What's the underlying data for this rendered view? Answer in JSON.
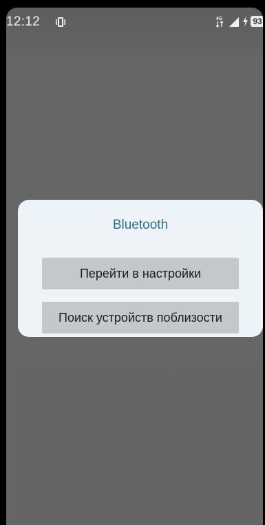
{
  "status_bar": {
    "time": "12:12",
    "network_label": "4G",
    "battery": "93",
    "icons": [
      "vibrate-icon",
      "network-4g-icon",
      "signal-icon",
      "charging-icon",
      "battery-icon"
    ]
  },
  "dialog": {
    "title": "Bluetooth",
    "buttons": [
      {
        "label": "Перейти в настройки"
      },
      {
        "label": "Поиск устройств поблизости"
      }
    ]
  },
  "colors": {
    "dialog_background": "#edf3f7",
    "title_color": "#2d6d93",
    "button_background": "#c4c8ca",
    "scrim": "#656565"
  }
}
